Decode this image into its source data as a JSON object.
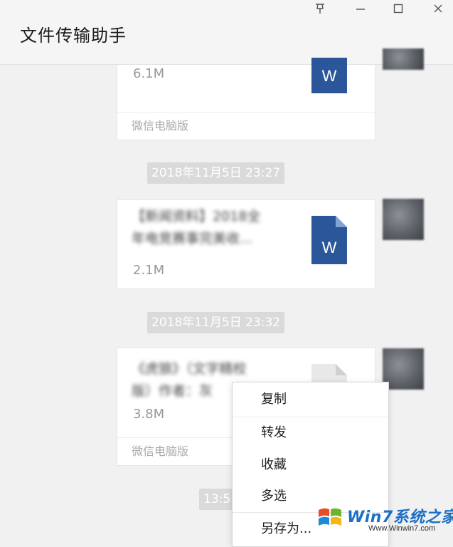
{
  "window": {
    "title": "文件传输助手",
    "pin_icon": "pin-icon",
    "minimize_icon": "minimize-icon",
    "maximize_icon": "maximize-icon",
    "close_icon": "close-icon"
  },
  "messages": [
    {
      "file_name": "",
      "file_size": "6.1M",
      "source": "微信电脑版",
      "file_icon": "word-doc-icon",
      "file_icon_letter": "W"
    },
    {
      "timestamp": "2018年11月5日 23:27",
      "file_name": "【新闻资料】2018全\n年电竞赛事完美收...",
      "file_size": "2.1M",
      "file_icon": "word-doc-icon",
      "file_icon_letter": "W"
    },
    {
      "timestamp": "2018年11月5日 23:32",
      "file_name": "《虎狼》（文字精校\n版）作者：灰",
      "file_size": "3.8M",
      "source": "微信电脑版",
      "file_icon": "generic-doc-icon"
    }
  ],
  "partial_timestamp": "13:5",
  "context_menu": {
    "items": [
      "复制",
      "转发",
      "收藏",
      "多选",
      "另存为..."
    ]
  },
  "watermark": {
    "brand": "Win7系统之家",
    "url": "Www.Winwin7.com"
  },
  "colors": {
    "word_blue": "#2b579a",
    "time_badge": "#dadada",
    "watermark_blue": "#1b6fc7"
  }
}
